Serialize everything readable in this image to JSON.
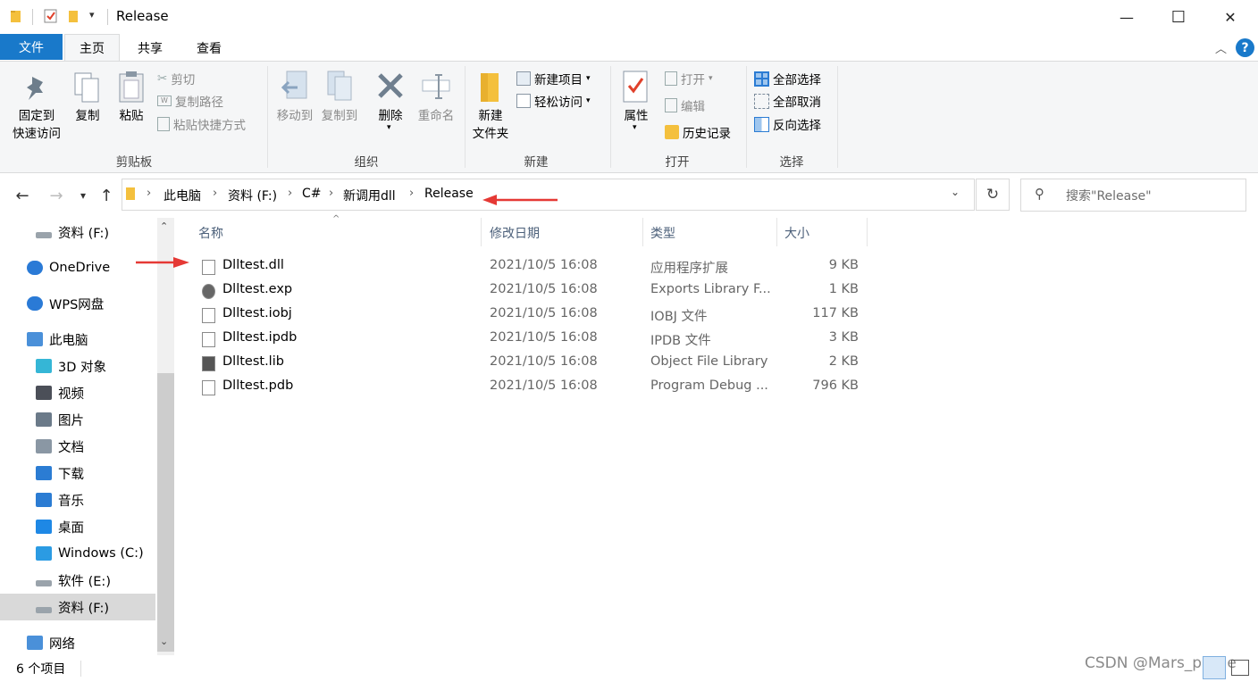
{
  "window": {
    "title": "Release",
    "controls": [
      "—",
      "☐",
      "✕"
    ]
  },
  "ribbon_tabs": {
    "file": "文件",
    "home": "主页",
    "share": "共享",
    "view": "查看"
  },
  "ribbon": {
    "clipboard": {
      "pin": "固定到",
      "pin2": "快速访问",
      "copy": "复制",
      "paste": "粘贴",
      "cut": "剪切",
      "copy_path": "复制路径",
      "paste_shortcut": "粘贴快捷方式",
      "label": "剪贴板"
    },
    "organize": {
      "move_to": "移动到",
      "copy_to": "复制到",
      "delete": "删除",
      "rename": "重命名",
      "label": "组织"
    },
    "new": {
      "new_folder": "新建",
      "new_folder2": "文件夹",
      "new_item": "新建项目",
      "easy_access": "轻松访问",
      "label": "新建"
    },
    "open": {
      "properties": "属性",
      "open": "打开",
      "edit": "编辑",
      "history": "历史记录",
      "label": "打开"
    },
    "select": {
      "select_all": "全部选择",
      "select_none": "全部取消",
      "invert": "反向选择",
      "label": "选择"
    }
  },
  "address": {
    "crumbs": [
      "此电脑",
      "资料 (F:)",
      "C#",
      "新调用dll",
      "Release"
    ],
    "search_placeholder": "搜索\"Release\""
  },
  "nav_pane": [
    {
      "label": "资料 (F:)",
      "icon": "drive-icon"
    },
    {
      "label": "OneDrive",
      "icon": "cloud-icon"
    },
    {
      "label": "WPS网盘",
      "icon": "cloud-icon"
    },
    {
      "label": "此电脑",
      "icon": "computer-icon"
    },
    {
      "label": "3D 对象",
      "icon": "cube-icon"
    },
    {
      "label": "视频",
      "icon": "video-icon"
    },
    {
      "label": "图片",
      "icon": "picture-icon"
    },
    {
      "label": "文档",
      "icon": "document-icon"
    },
    {
      "label": "下载",
      "icon": "download-icon"
    },
    {
      "label": "音乐",
      "icon": "music-icon"
    },
    {
      "label": "桌面",
      "icon": "desktop-icon"
    },
    {
      "label": "Windows (C:)",
      "icon": "windows-drive-icon"
    },
    {
      "label": "软件 (E:)",
      "icon": "drive-icon"
    },
    {
      "label": "资料 (F:)",
      "icon": "drive-icon"
    },
    {
      "label": "网络",
      "icon": "network-icon"
    }
  ],
  "columns": {
    "name": "名称",
    "date": "修改日期",
    "type": "类型",
    "size": "大小"
  },
  "files": [
    {
      "name": "Dlltest.dll",
      "date": "2021/10/5 16:08",
      "type": "应用程序扩展",
      "size": "9 KB",
      "icon": "dll-icon"
    },
    {
      "name": "Dlltest.exp",
      "date": "2021/10/5 16:08",
      "type": "Exports Library F...",
      "size": "1 KB",
      "icon": "gear-file-icon"
    },
    {
      "name": "Dlltest.iobj",
      "date": "2021/10/5 16:08",
      "type": "IOBJ 文件",
      "size": "117 KB",
      "icon": "blank-file-icon"
    },
    {
      "name": "Dlltest.ipdb",
      "date": "2021/10/5 16:08",
      "type": "IPDB 文件",
      "size": "3 KB",
      "icon": "blank-file-icon"
    },
    {
      "name": "Dlltest.lib",
      "date": "2021/10/5 16:08",
      "type": "Object File Library",
      "size": "2 KB",
      "icon": "library-icon"
    },
    {
      "name": "Dlltest.pdb",
      "date": "2021/10/5 16:08",
      "type": "Program Debug ...",
      "size": "796 KB",
      "icon": "debug-file-icon"
    }
  ],
  "status": {
    "count": "6 个项目"
  },
  "watermark": "CSDN @Mars_prime",
  "colors": {
    "file_tab": "#1979ca",
    "annotation_arrow": "#e53935",
    "help": "#1979ca"
  }
}
